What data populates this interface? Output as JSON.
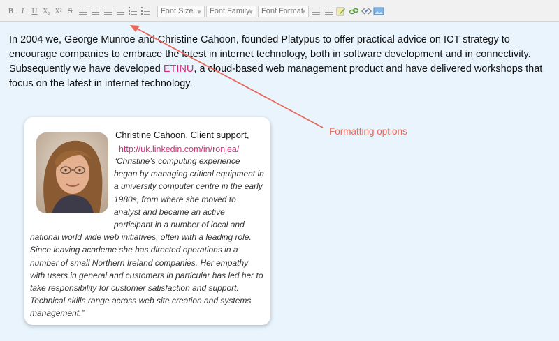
{
  "toolbar": {
    "bold_label": "B",
    "italic_label": "I",
    "underline_label": "U",
    "subscript_label": "X₂",
    "superscript_label": "X²",
    "strike_label": "S",
    "font_size_label": "Font Size...",
    "font_family_label": "Font Family.",
    "font_format_label": "Font Format"
  },
  "content": {
    "intro_before": "In 2004 we, George Munroe and Christine Cahoon, founded Platypus to offer practical advice on ICT strategy to encourage companies to embrace the latest in internet technology, both in software development and in connectivity. Subsequently we have developed ",
    "intro_link": "ETINU",
    "intro_after": ", a cloud-based web management product and have delivered workshops that focus on the latest in internet technology."
  },
  "profile": {
    "name_role": "Christine Cahoon, Client support,",
    "link": "http://uk.linkedin.com/in/ronjea/",
    "quote": "“Christine’s computing experience began by managing critical equipment in a university computer centre in the early 1980s, from where she moved to analyst and became an active participant in a number of local and national world wide web initiatives, often with a leading role. Since leaving academe she has directed operations in a number of small Northern Ireland companies. Her empathy with users in general and customers in particular has led her to take responsibility for customer satisfaction and support. Technical skills range across web site creation and systems management.”"
  },
  "annotation": {
    "label": "Formatting options"
  },
  "colors": {
    "editor_bg": "#e9f4fd",
    "link": "#d62c7c",
    "annotation": "#e8695c"
  }
}
